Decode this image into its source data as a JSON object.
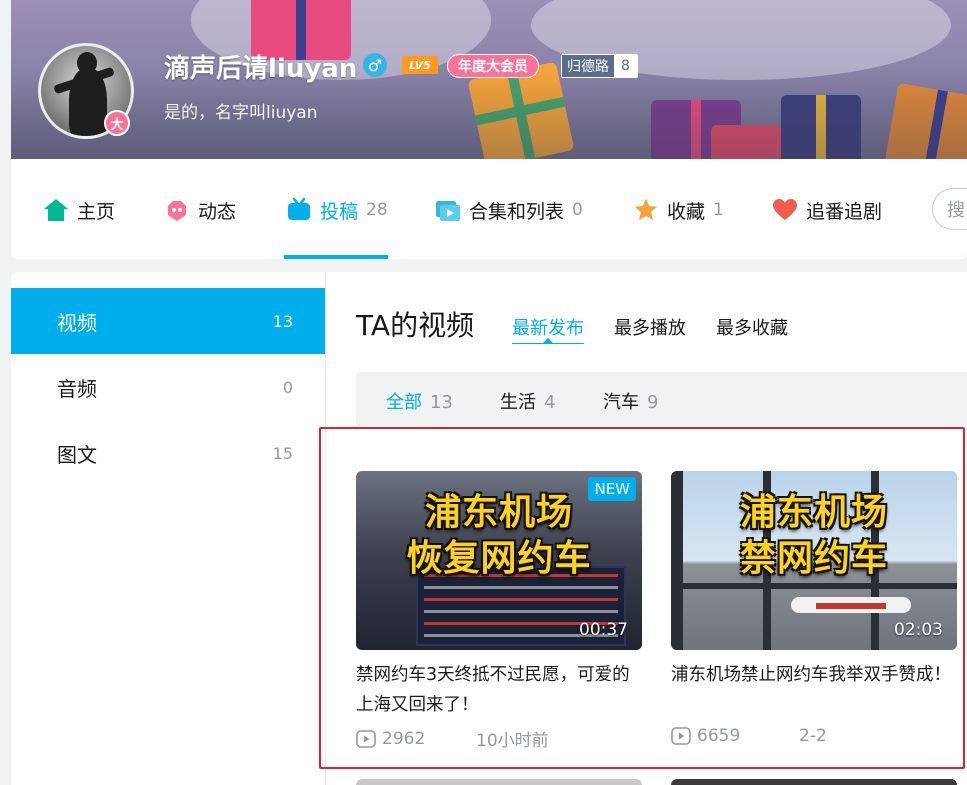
{
  "header": {
    "user_name": "滴声后请liuyan",
    "avatar_badge": "大",
    "gender_icon": "male-icon",
    "level_badge": "LV5",
    "vip_label": "年度大会员",
    "medal_name": "归德路",
    "medal_level": "8",
    "signature": "是的，名字叫liuyan"
  },
  "nav": {
    "items": [
      {
        "label": "主页",
        "count": "",
        "icon": "home-icon"
      },
      {
        "label": "动态",
        "count": "",
        "icon": "dynamic-icon"
      },
      {
        "label": "投稿",
        "count": "28",
        "icon": "tv-icon"
      },
      {
        "label": "合集和列表",
        "count": "0",
        "icon": "collection-icon"
      },
      {
        "label": "收藏",
        "count": "1",
        "icon": "star-icon"
      },
      {
        "label": "追番追剧",
        "count": "",
        "icon": "heart-icon"
      }
    ],
    "active_index": 2,
    "search_placeholder": "搜"
  },
  "sidebar": {
    "items": [
      {
        "label": "视频",
        "count": "13"
      },
      {
        "label": "音频",
        "count": "0"
      },
      {
        "label": "图文",
        "count": "15"
      }
    ]
  },
  "content": {
    "title": "TA的视频",
    "sort_tabs": [
      "最新发布",
      "最多播放",
      "最多收藏"
    ],
    "filters": [
      {
        "label": "全部",
        "count": "13"
      },
      {
        "label": "生活",
        "count": "4"
      },
      {
        "label": "汽车",
        "count": "9"
      }
    ],
    "videos": [
      {
        "thumb_line1": "浦东机场",
        "thumb_line2": "恢复网约车",
        "badge": "NEW",
        "duration": "00:37",
        "title": "禁网约车3天终抵不过民愿，可爱的上海又回来了！",
        "plays": "2962",
        "date": "10小时前"
      },
      {
        "thumb_line1": "浦东机场",
        "thumb_line2": "禁网约车",
        "badge": "",
        "duration": "02:03",
        "title": "浦东机场禁止网约车我举双手赞成！",
        "plays": "6659",
        "date": "2-2"
      }
    ]
  },
  "colors": {
    "accent": "#00aeec",
    "vip_pink": "#fb7299",
    "highlight_red": "#e0232a",
    "muted": "#9499a0"
  }
}
